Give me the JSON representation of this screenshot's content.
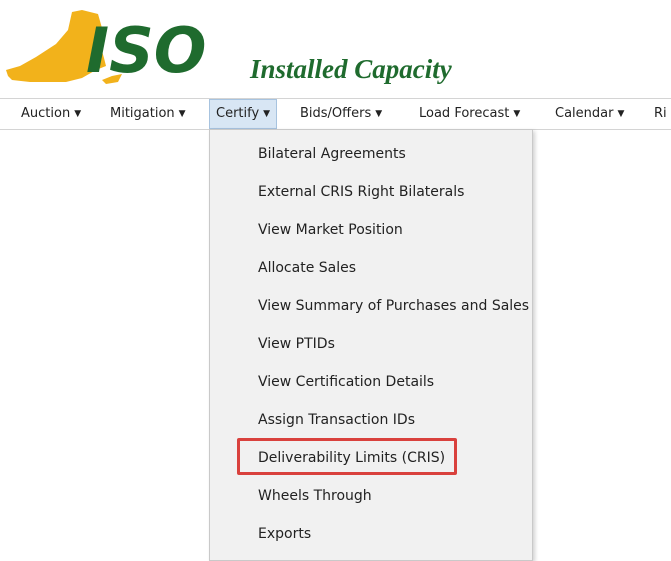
{
  "header": {
    "logo_text": "ISO",
    "app_title": "Installed Capacity"
  },
  "colors": {
    "logo_state": "#f2b21b",
    "logo_text": "#1f6b2e",
    "title": "#1f6b2e",
    "active_menu": "#d8e6f4",
    "highlight": "#d9413d"
  },
  "menubar": {
    "items": [
      {
        "label": "Auction"
      },
      {
        "label": "Mitigation"
      },
      {
        "label": "Certify"
      },
      {
        "label": "Bids/Offers"
      },
      {
        "label": "Load Forecast"
      },
      {
        "label": "Calendar"
      },
      {
        "label": "Ri"
      }
    ],
    "active": "Certify"
  },
  "certify_menu": {
    "items": [
      {
        "label": "Bilateral Agreements"
      },
      {
        "label": "External CRIS Right Bilaterals"
      },
      {
        "label": "View Market Position"
      },
      {
        "label": "Allocate Sales"
      },
      {
        "label": "View Summary of Purchases and Sales"
      },
      {
        "label": "View PTIDs"
      },
      {
        "label": "View Certification Details"
      },
      {
        "label": "Assign Transaction IDs"
      },
      {
        "label": "Deliverability Limits (CRIS)"
      },
      {
        "label": "Wheels Through"
      },
      {
        "label": "Exports"
      }
    ],
    "highlighted": "Deliverability Limits (CRIS)"
  }
}
